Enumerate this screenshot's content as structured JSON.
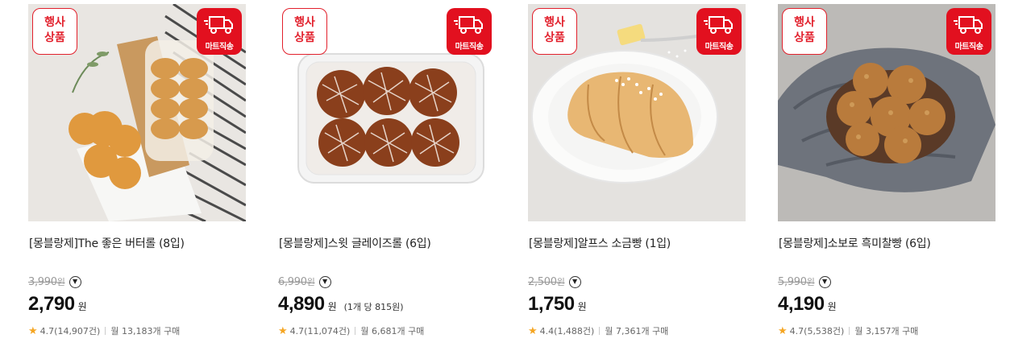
{
  "badges": {
    "event_line1": "행사",
    "event_line2": "상품",
    "delivery_label": "마트직송"
  },
  "products": [
    {
      "title": "[몽블랑제]The 좋은 버터롤 (8입)",
      "original_price": "3,990",
      "won": "원",
      "price": "2,790",
      "unit_price": "",
      "rating": "4.7(14,907건)",
      "monthly_sales": "월 13,183개 구매",
      "image": "butter-roll-bag"
    },
    {
      "title": "[몽블랑제]스윗 글레이즈롤 (6입)",
      "original_price": "6,990",
      "won": "원",
      "price": "4,890",
      "unit_price": "(1개 당 815원)",
      "rating": "4.7(11,074건)",
      "monthly_sales": "월 6,681개 구매",
      "image": "glaze-rolls-container"
    },
    {
      "title": "[몽블랑제]알프스 소금빵 (1입)",
      "original_price": "2,500",
      "won": "원",
      "price": "1,750",
      "unit_price": "",
      "rating": "4.4(1,488건)",
      "monthly_sales": "월 7,361개 구매",
      "image": "salt-bread-plate"
    },
    {
      "title": "[몽블랑제]소보로 흑미찰빵 (6입)",
      "original_price": "5,990",
      "won": "원",
      "price": "4,190",
      "unit_price": "",
      "rating": "4.7(5,538건)",
      "monthly_sales": "월 3,157개 구매",
      "image": "soboro-bread-bowl"
    }
  ],
  "colors": {
    "accent_red": "#e2101f",
    "star": "#f5a623"
  }
}
